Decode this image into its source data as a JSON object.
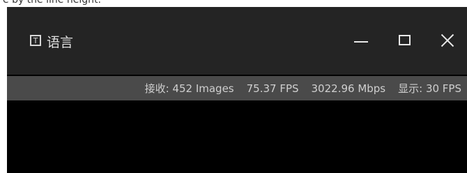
{
  "top_caption": "e by the line height.",
  "window": {
    "title": "语言",
    "lang_icon_glyph": "T",
    "icons": {
      "language": "language-icon",
      "minimize": "minimize-icon",
      "maximize": "maximize-icon",
      "close": "close-icon"
    }
  },
  "status": {
    "received": "接收: 452 Images",
    "fps": "75.37 FPS",
    "bandwidth": "3022.96 Mbps",
    "display": "显示: 30 FPS"
  },
  "colors": {
    "titlebar": "#242424",
    "statusbar": "#4a4a4a",
    "video_area": "#000000"
  }
}
